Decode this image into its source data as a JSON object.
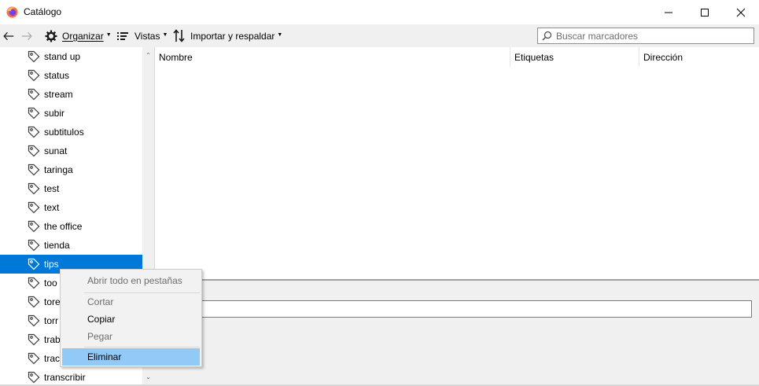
{
  "window": {
    "title": "Catálogo",
    "icon": "firefox-icon"
  },
  "toolbar": {
    "organize_label": "Organizar",
    "views_label": "Vistas",
    "import_label": "Importar y respaldar",
    "search_placeholder": "Buscar marcadores"
  },
  "tree": {
    "items": [
      {
        "label": "stand up"
      },
      {
        "label": "status"
      },
      {
        "label": "stream"
      },
      {
        "label": "subir"
      },
      {
        "label": "subtitulos"
      },
      {
        "label": "sunat"
      },
      {
        "label": "taringa"
      },
      {
        "label": "test"
      },
      {
        "label": "text"
      },
      {
        "label": "the office"
      },
      {
        "label": "tienda"
      },
      {
        "label": "tips",
        "selected": true
      },
      {
        "label": "too"
      },
      {
        "label": "tore"
      },
      {
        "label": "torr"
      },
      {
        "label": "trab"
      },
      {
        "label": "trac"
      },
      {
        "label": "transcribir"
      }
    ]
  },
  "list": {
    "columns": [
      "Nombre",
      "Etiquetas",
      "Dirección"
    ]
  },
  "context_menu": {
    "items": [
      {
        "label": "Abrir todo en pestañas",
        "disabled": true
      },
      {
        "label": "Cortar",
        "disabled": true
      },
      {
        "label": "Copiar",
        "disabled": false
      },
      {
        "label": "Pegar",
        "disabled": true
      },
      {
        "label": "Eliminar",
        "disabled": false,
        "highlighted": true
      }
    ]
  },
  "colors": {
    "selection": "#0078d7",
    "menu_highlight": "#91c9f7",
    "toolbar_bg": "#f0f0f0"
  }
}
